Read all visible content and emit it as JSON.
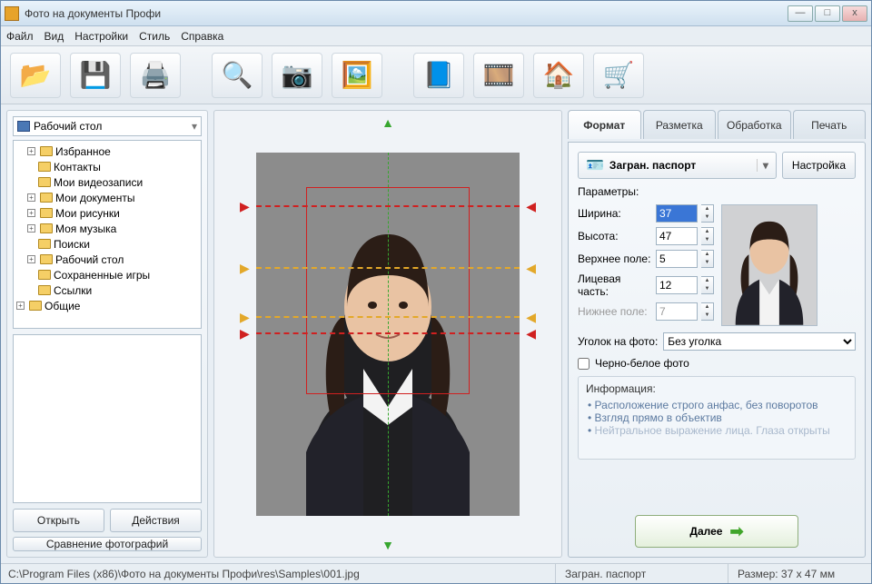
{
  "window": {
    "title": "Фото на документы Профи"
  },
  "menu": {
    "file": "Файл",
    "view": "Вид",
    "settings": "Настройки",
    "style": "Стиль",
    "help": "Справка"
  },
  "toolbar_icons": [
    "open",
    "save",
    "print",
    "identify",
    "camera",
    "retouch",
    "help",
    "video",
    "home",
    "cart"
  ],
  "sidebar": {
    "location": "Рабочий стол",
    "tree": [
      {
        "label": "Избранное",
        "exp": "+"
      },
      {
        "label": "Контакты",
        "exp": ""
      },
      {
        "label": "Мои видеозаписи",
        "exp": ""
      },
      {
        "label": "Мои документы",
        "exp": "+"
      },
      {
        "label": "Мои рисунки",
        "exp": "+"
      },
      {
        "label": "Моя музыка",
        "exp": "+"
      },
      {
        "label": "Поиски",
        "exp": ""
      },
      {
        "label": "Рабочий стол",
        "exp": "+"
      },
      {
        "label": "Сохраненные игры",
        "exp": ""
      },
      {
        "label": "Ссылки",
        "exp": ""
      },
      {
        "label": "Общие",
        "exp": "+"
      }
    ],
    "open_btn": "Открыть",
    "actions_btn": "Действия",
    "compare_btn": "Сравнение фотографий"
  },
  "tabs": {
    "format": "Формат",
    "layout": "Разметка",
    "processing": "Обработка",
    "print": "Печать"
  },
  "format": {
    "doc_type": "Загран. паспорт",
    "settings_btn": "Настройка",
    "params_label": "Параметры:",
    "width_label": "Ширина:",
    "width_value": "37",
    "height_label": "Высота:",
    "height_value": "47",
    "top_label": "Верхнее поле:",
    "top_value": "5",
    "face_label": "Лицевая часть:",
    "face_value": "12",
    "bottom_label": "Нижнее поле:",
    "bottom_value": "7",
    "corner_label": "Уголок на фото:",
    "corner_value": "Без уголка",
    "bw_label": "Черно-белое фото",
    "info_title": "Информация:",
    "info_items": [
      "Расположение строго анфас, без поворотов",
      "Взгляд прямо в объектив",
      "Нейтральное выражение лица. Глаза открыты"
    ],
    "next_btn": "Далее"
  },
  "status": {
    "path": "C:\\Program Files (x86)\\Фото на документы Профи\\res\\Samples\\001.jpg",
    "doc": "Загран. паспорт",
    "size": "Размер: 37 x 47 мм"
  }
}
